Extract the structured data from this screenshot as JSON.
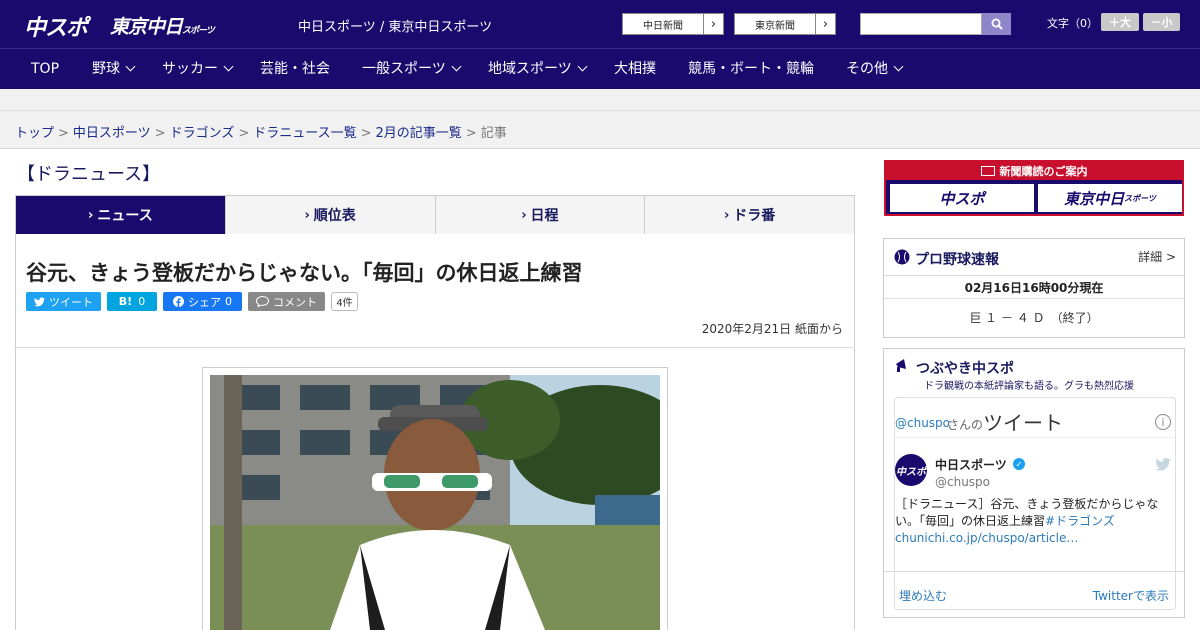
{
  "header": {
    "logo_chuspo": "中スポ",
    "logo_tokyo": "東京中日",
    "logo_tokyo_sub": "スポーツ",
    "site_title": "中日スポーツ / 東京中日スポーツ",
    "ext_links": [
      "中日新聞",
      "東京新聞"
    ],
    "search": {
      "placeholder": "",
      "value": ""
    },
    "font_size_label": "文字（0）",
    "font_plus": "＋大",
    "font_minus": "－小"
  },
  "nav": {
    "items": [
      {
        "label": "TOP",
        "dropdown": false
      },
      {
        "label": "野球",
        "dropdown": true
      },
      {
        "label": "サッカー",
        "dropdown": true
      },
      {
        "label": "芸能・社会",
        "dropdown": false
      },
      {
        "label": "一般スポーツ",
        "dropdown": true
      },
      {
        "label": "地域スポーツ",
        "dropdown": true
      },
      {
        "label": "大相撲",
        "dropdown": false
      },
      {
        "label": "競馬・ボート・競輪",
        "dropdown": false
      },
      {
        "label": "その他",
        "dropdown": true
      }
    ]
  },
  "breadcrumb": {
    "links": [
      "トップ",
      "中日スポーツ",
      "ドラゴンズ",
      "ドラニュース一覧",
      "2月の記事一覧"
    ],
    "separator": ">",
    "current": "記事"
  },
  "section": {
    "title": "【ドラニュース】"
  },
  "tabs": [
    {
      "label": "ニュース",
      "active": true
    },
    {
      "label": "順位表",
      "active": false
    },
    {
      "label": "日程",
      "active": false
    },
    {
      "label": "ドラ番",
      "active": false
    }
  ],
  "article": {
    "headline": "谷元、きょう登板だからじゃない。「毎回」の休日返上練習",
    "share": {
      "tweet": "ツイート",
      "hatena": "B!",
      "hatena_count": "0",
      "facebook": "シェア",
      "facebook_count": "0",
      "comment": "コメント",
      "comment_count": "4件"
    },
    "dateline": "2020年2月21日 紙面から"
  },
  "sidebar": {
    "ad": {
      "head": "新聞購読のご案内",
      "logo1": "中スポ",
      "logo2": "東京中日",
      "logo2_sub": "スポーツ"
    },
    "baseball": {
      "title": "プロ野球速報",
      "detail": "詳細 >",
      "timestamp": "02月16日16時00分現在",
      "score": "巨 １ － ４ Ｄ　（終了）"
    },
    "tsubuyaki": {
      "title": "つぶやき中スポ",
      "subtitle": "ドラ観戦の本紙評論家も語る。グラも熱烈応援",
      "handle_prefix": "@chuspo",
      "handle_suffix": "さんの",
      "tweets_label": "ツイート",
      "account_name": "中日スポーツ",
      "account_handle": "@chuspo",
      "tweet_text": "［ドラニュース］谷元、きょう登板だからじゃない。「毎回」の休日返上練習",
      "tweet_hashtag": "#ドラゴンズ",
      "tweet_link": "chunichi.co.jp/chuspo/article…",
      "embed": "埋め込む",
      "view_on": "Twitterで表示"
    }
  },
  "colors": {
    "brand": "#1a0a6e",
    "accent_red": "#c8102e",
    "twitter": "#1da1f2",
    "facebook": "#1877f2",
    "hatena": "#00a4de"
  }
}
